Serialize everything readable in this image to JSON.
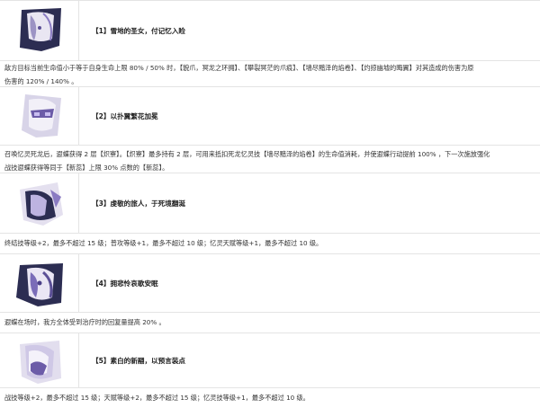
{
  "eidolons": [
    {
      "icon": "eidolon-1-portrait",
      "title": "【1】雪地的圣女，付记忆入睑",
      "description_lines": [
        "敌方目标当前生命值小于等于自身生命上限 80% / 50% 时，【貌爪，冥龙之环拥】、【攀裂冥茫的爪痕】、【墙尽黯泽的焰卷】、【灼掠幽墟的晦翼】对其造成的伤害为原",
        "伤害的 120% / 140% 。"
      ]
    },
    {
      "icon": "eidolon-2-portrait",
      "title": "【2】以扑翼繁花加冕",
      "description_lines": [
        "召唤忆灵死龙后，遐蝶获得 2 层【炽寮】。【炽寮】最多持有 2 层，可用来抵扣死龙忆灵技【墙尽黯泽的焰卷】的生命值消耗，并使遐蝶行动提前 100% ，下一次施放强化",
        "战技遐蝶获得等同于【新蕊】上限 30% 点数的【新蕊】。"
      ]
    },
    {
      "icon": "eidolon-3-portrait",
      "title": "【3】虔敬的旅人，于死境翻涎",
      "description_lines": [
        "终结技等级+2，最多不超过 15 级；普攻等级+1，最多不超过 10 级；忆灵天赋等级+1，最多不超过 10 级。"
      ]
    },
    {
      "icon": "eidolon-4-portrait",
      "title": "【4】拥悲怜哀歌安眠",
      "description_lines": [
        "遐蝶在场时，我方全体受到治疗时的回复量提高 20% 。"
      ]
    },
    {
      "icon": "eidolon-5-portrait",
      "title": "【5】素白的新翮，以预言装点",
      "description_lines": [
        "战技等级+2，最多不超过 15 级；天赋等级+2，最多不超过 15 级；忆灵技等级+1，最多不超过 10 级。"
      ]
    }
  ],
  "colors": {
    "border": "#e4e4e4",
    "portrait_dark": "#2c2d52",
    "portrait_light": "#e9e6f2",
    "accent_purple": "#8a7bc2"
  }
}
